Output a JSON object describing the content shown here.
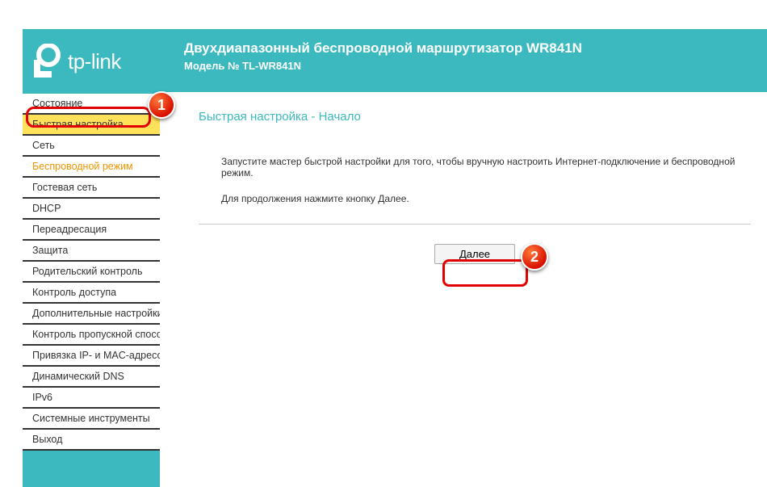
{
  "brand": "tp-link",
  "header": {
    "title": "Двухдиапазонный беспроводной маршрутизатор WR841N",
    "model": "Модель № TL-WR841N"
  },
  "sidebar": {
    "items": [
      {
        "label": "Состояние",
        "state": ""
      },
      {
        "label": "Быстрая настройка",
        "state": "selected"
      },
      {
        "label": "Сеть",
        "state": ""
      },
      {
        "label": "Беспроводной режим",
        "state": "active-orange"
      },
      {
        "label": "Гостевая сеть",
        "state": ""
      },
      {
        "label": "DHCP",
        "state": ""
      },
      {
        "label": "Переадресация",
        "state": ""
      },
      {
        "label": "Защита",
        "state": ""
      },
      {
        "label": "Родительский контроль",
        "state": ""
      },
      {
        "label": "Контроль доступа",
        "state": ""
      },
      {
        "label": "Дополнительные настройки",
        "state": ""
      },
      {
        "label": "Контроль пропускной способности",
        "state": ""
      },
      {
        "label": "Привязка IP- и MAC-адресов",
        "state": ""
      },
      {
        "label": "Динамический DNS",
        "state": ""
      },
      {
        "label": "IPv6",
        "state": ""
      },
      {
        "label": "Системные инструменты",
        "state": ""
      },
      {
        "label": "Выход",
        "state": ""
      }
    ]
  },
  "content": {
    "title": "Быстрая настройка - Начало",
    "line1": "Запустите мастер быстрой настройки для того, чтобы вручную настроить Интернет-подключение и беспроводной режим.",
    "line2": "Для продолжения нажмите кнопку Далее.",
    "next_btn": "Далее"
  },
  "annotations": {
    "badge1": "1",
    "badge2": "2"
  }
}
